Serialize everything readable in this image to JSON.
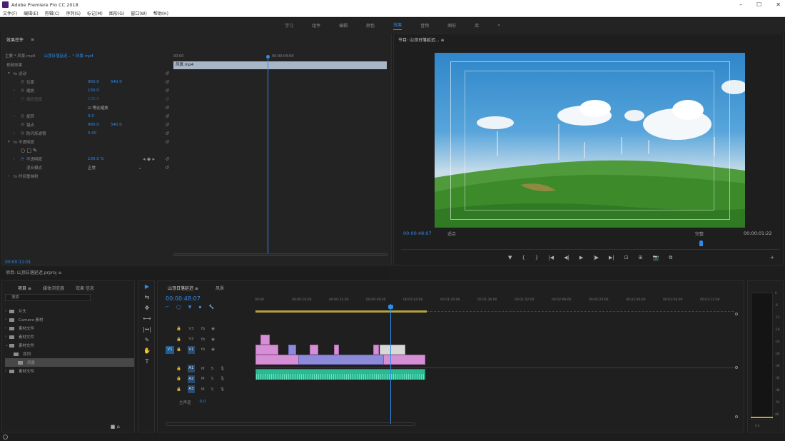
{
  "titlebar": {
    "title": "Adobe Premiere Pro CC 2018",
    "controls": [
      "–",
      "☐",
      "✕"
    ]
  },
  "menu": [
    "文件(F)",
    "编辑(E)",
    "剪辑(C)",
    "序列(S)",
    "标记(M)",
    "图形(G)",
    "窗口(W)",
    "帮助(H)"
  ],
  "workspaces": {
    "items": [
      "学习",
      "组件",
      "编辑",
      "颜色",
      "效果",
      "音频",
      "图形",
      "库"
    ],
    "active_index": 4,
    "more": "»"
  },
  "effects_panel": {
    "tab": "效果控件",
    "tab_menu": "≡",
    "source_label": "主要 * 风景.mp4",
    "clip_label": "山顶日落延迟... * 风景.mp4",
    "section_label": "视频效果",
    "ruler_start": "00:00",
    "ruler_mark": "00:00:04:00",
    "clip_name": "风景.mp4",
    "timecode": "00:00:11:01",
    "rows": [
      {
        "tri": "▾",
        "name": "fx 运动",
        "v1": "",
        "v2": ""
      },
      {
        "tri": "",
        "name": "位置",
        "v1": "960.0",
        "v2": "540.0"
      },
      {
        "tri": "›",
        "name": "缩放",
        "v1": "100.0",
        "v2": ""
      },
      {
        "tri": "›",
        "name": "缩放宽度",
        "v1": "100.0",
        "v2": ""
      },
      {
        "tri": "",
        "name": "",
        "v1": "☑ 等比缩放",
        "v2": ""
      },
      {
        "tri": "›",
        "name": "旋转",
        "v1": "0.0",
        "v2": ""
      },
      {
        "tri": "",
        "name": "锚点",
        "v1": "960.0",
        "v2": "540.0"
      },
      {
        "tri": "›",
        "name": "防闪烁滤镜",
        "v1": "0.00",
        "v2": ""
      },
      {
        "tri": "▾",
        "name": "fx 不透明度",
        "v1": "",
        "v2": ""
      },
      {
        "tri": "",
        "name": "○ □ ✎",
        "v1": "",
        "v2": ""
      },
      {
        "tri": "›",
        "name": "不透明度",
        "v1": "100.0 %",
        "v2": ""
      },
      {
        "tri": "",
        "name": "混合模式",
        "v1": "正常",
        "v2": ""
      },
      {
        "tri": "›",
        "name": "fx 时间重映射",
        "v1": "",
        "v2": ""
      }
    ]
  },
  "program_monitor": {
    "tab": "节目: 山顶日落延迟... ≡",
    "timecode": "00:00:48:07",
    "fit": "适合",
    "quality": "完整",
    "duration": "00:00:01:22",
    "transport": [
      "▼",
      "{",
      "}",
      "|◀",
      "◀|",
      "▶",
      "|▶",
      "▶|",
      "⊡",
      "⊞",
      "📷",
      "⧉"
    ],
    "settings": "+"
  },
  "project_panel": {
    "header": "项目: 山顶日落延迟.prproj  ≡",
    "tabs": [
      "项目 ≡",
      "媒体浏览器",
      "效果 信息"
    ],
    "search_placeholder": "搜索",
    "items": [
      {
        "label": "片头",
        "selected": false
      },
      {
        "label": "Camera 素材",
        "selected": false
      },
      {
        "label": "素材文件",
        "selected": false
      },
      {
        "label": "素材文件",
        "selected": false
      },
      {
        "label": "素材文件",
        "selected": false
      },
      {
        "label": "序列",
        "selected": false
      },
      {
        "label": "风景",
        "selected": true
      },
      {
        "label": "素材文件",
        "selected": false
      }
    ],
    "footer": "■  ⌂"
  },
  "tools": [
    "▶",
    "⇆",
    "✥",
    "⟷",
    "|↔|",
    "✎",
    "✋",
    "T"
  ],
  "timeline": {
    "tabs": [
      "山顶日落延迟 ≡",
      "风景"
    ],
    "timecode": "00:00:48:07",
    "tool_icons": [
      "⌐",
      "◯",
      "▼",
      "▪",
      "🔧"
    ],
    "ruler_labels": [
      "00:00",
      "00:00:16:00",
      "00:00:32:00",
      "00:00:48:00",
      "00:01:04:00",
      "00:01:20:00",
      "00:01:36:00",
      "00:01:52:00",
      "00:02:08:00",
      "00:02:24:00",
      "00:02:40:00",
      "00:02:56:00",
      "00:03:12:00"
    ],
    "video_tracks": [
      "V3",
      "V2",
      "V1"
    ],
    "audio_tracks": [
      "A1",
      "A2",
      "A3"
    ],
    "source_patch": "V1",
    "master_label": "主声道",
    "master_value": "0.0",
    "track_icons": [
      "fb",
      "⊙",
      "◉"
    ]
  },
  "meters": {
    "ticks": [
      "0",
      "-6",
      "-12",
      "-18",
      "-24",
      "-30",
      "-36",
      "-42",
      "-48",
      "-54",
      "dB"
    ],
    "footer": "S S"
  }
}
